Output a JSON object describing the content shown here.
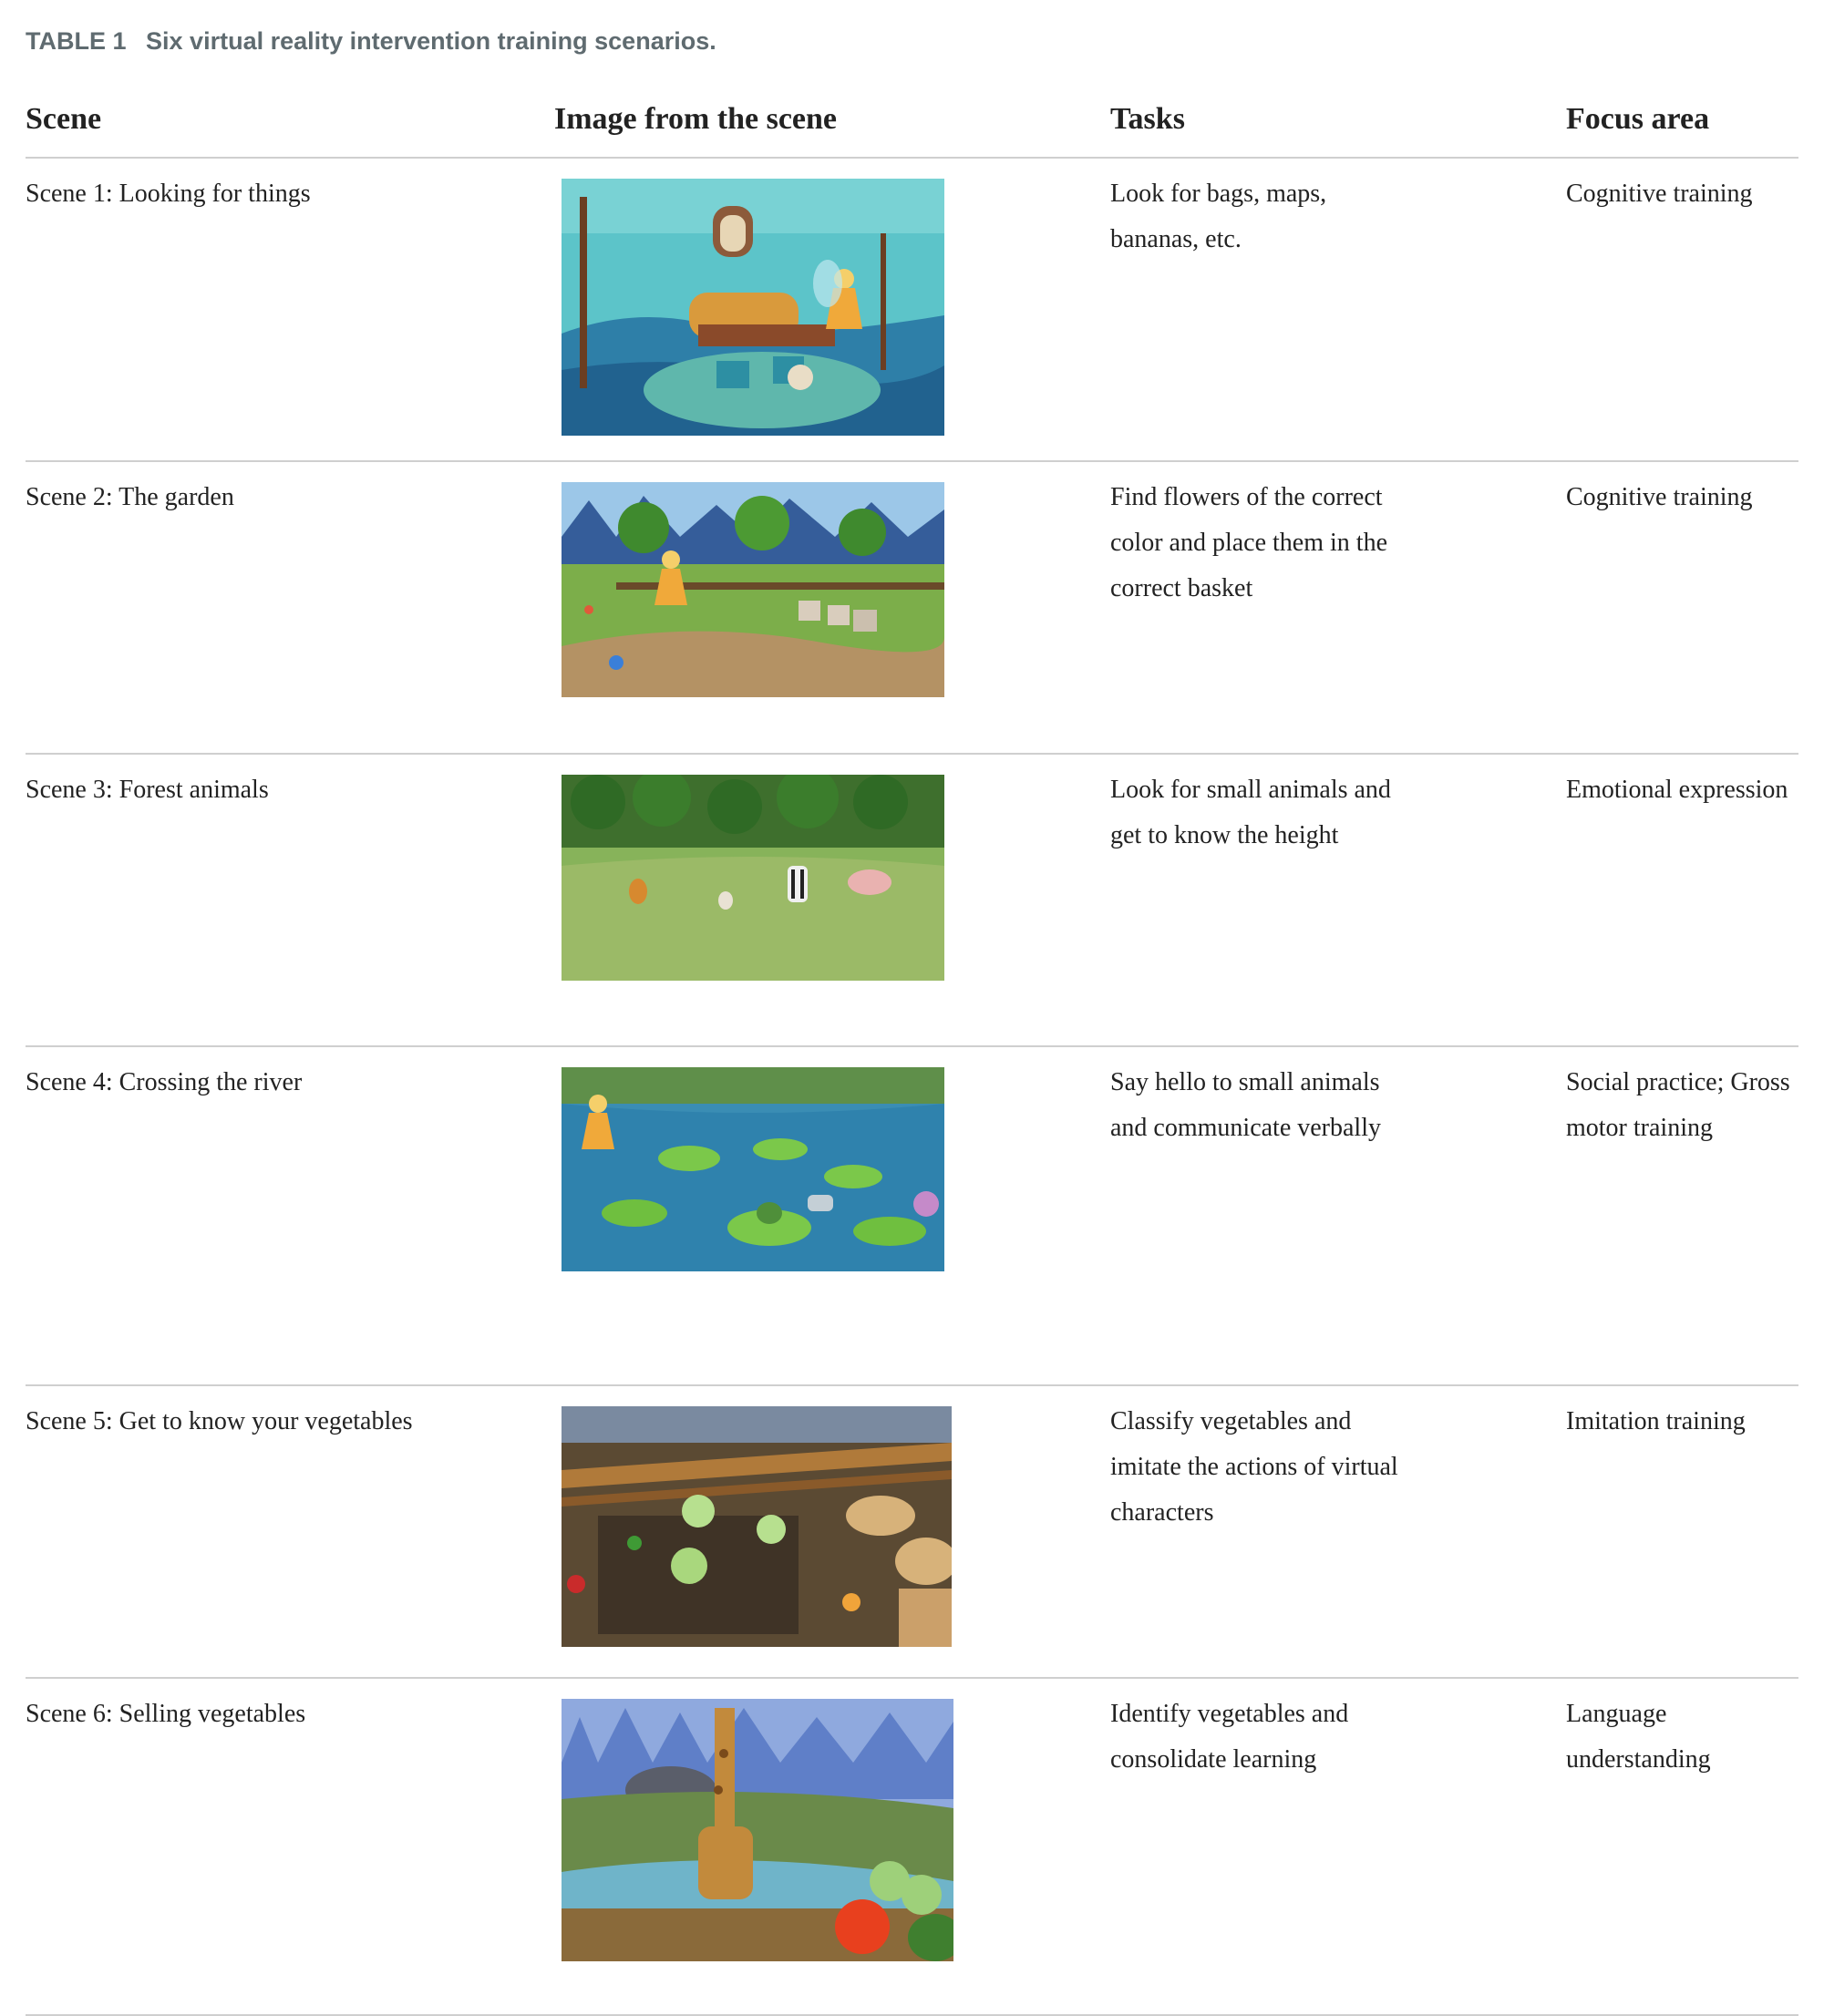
{
  "caption": {
    "label": "TABLE 1",
    "text": "Six virtual reality intervention training scenarios."
  },
  "headers": {
    "scene": "Scene",
    "image": "Image from the scene",
    "tasks": "Tasks",
    "focus": "Focus area"
  },
  "rows": [
    {
      "scene": "Scene 1: Looking for things",
      "tasks": "Look for bags, maps, bananas, etc.",
      "focus": "Cognitive training"
    },
    {
      "scene": "Scene 2: The garden",
      "tasks": "Find flowers of the correct color and place them in the correct basket",
      "focus": "Cognitive training"
    },
    {
      "scene": "Scene 3: Forest animals",
      "tasks": "Look for small animals and get to know the height",
      "focus": "Emotional expression"
    },
    {
      "scene": "Scene 4: Crossing the river",
      "tasks": "Say hello to small animals and communicate verbally",
      "focus": "Social practice; Gross motor training"
    },
    {
      "scene": "Scene 5: Get to know your vegetables",
      "tasks": "Classify vegetables and imitate the actions of virtual characters",
      "focus": "Imitation training"
    },
    {
      "scene": "Scene 6: Selling vegetables",
      "tasks": "Identify vegetables and consolidate learning",
      "focus": "Language understanding"
    }
  ]
}
